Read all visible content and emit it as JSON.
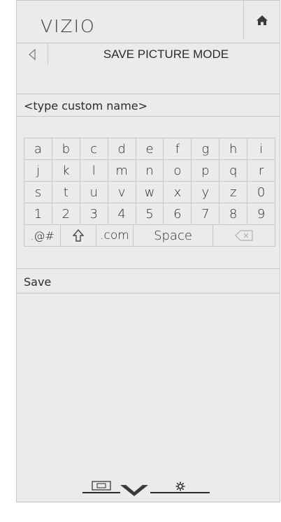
{
  "header": {
    "logo": "VIZIO",
    "home_icon": "home-icon"
  },
  "titlebar": {
    "back_icon": "back-arrow-icon",
    "title": "SAVE PICTURE MODE"
  },
  "name_field": {
    "placeholder": "<type custom name>"
  },
  "keyboard": {
    "rows": [
      [
        "a",
        "b",
        "c",
        "d",
        "e",
        "f",
        "g",
        "h",
        "i"
      ],
      [
        "j",
        "k",
        "l",
        "m",
        "n",
        "o",
        "p",
        "q",
        "r"
      ],
      [
        "s",
        "t",
        "u",
        "v",
        "w",
        "x",
        "y",
        "z",
        "0"
      ],
      [
        "1",
        "2",
        "3",
        "4",
        "5",
        "6",
        "7",
        "8",
        "9"
      ]
    ],
    "symbols_label": ".@#",
    "shift_icon": "shift-icon",
    "com_label": ".com",
    "space_label": "Space",
    "delete_icon": "backspace-icon"
  },
  "save": {
    "label": "Save"
  },
  "bottom_nav": {
    "items": [
      "input-icon",
      "menu-chevron-icon",
      "settings-gear-icon"
    ]
  }
}
